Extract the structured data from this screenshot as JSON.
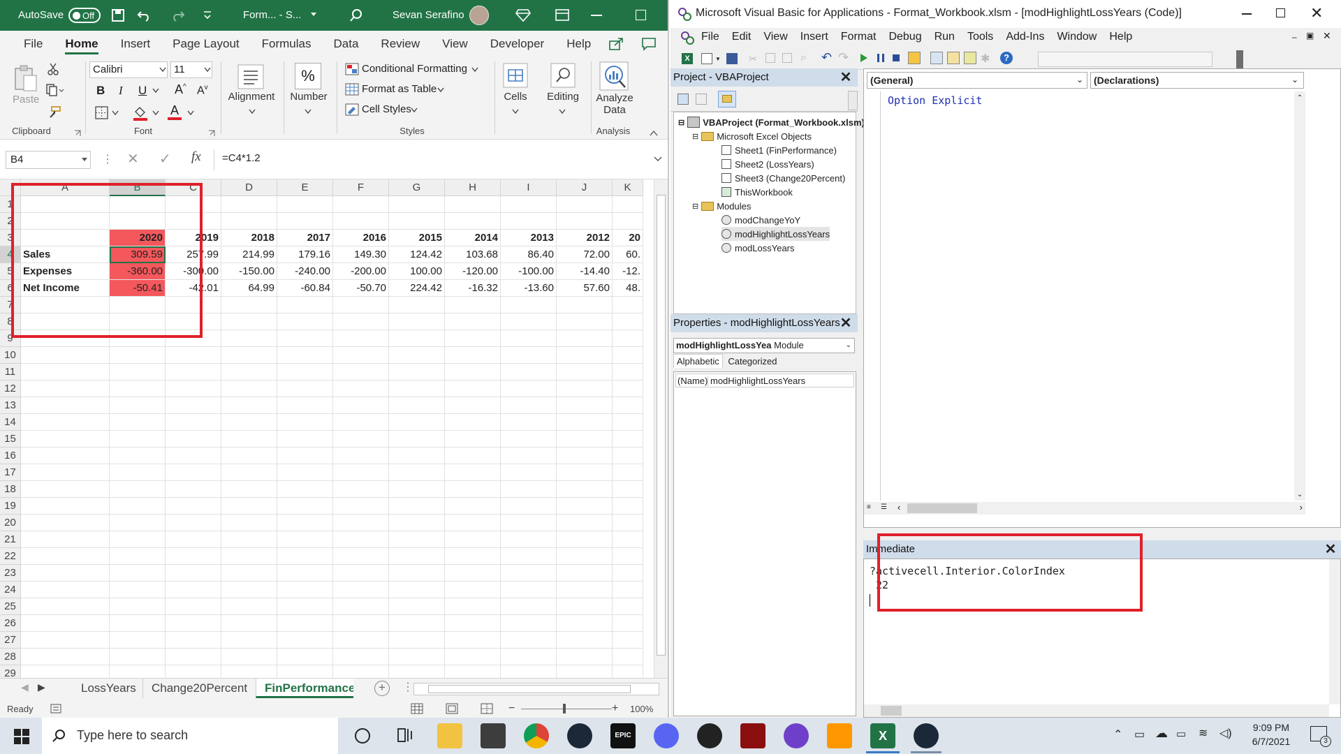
{
  "excel": {
    "autosave_label": "AutoSave",
    "autosave_state": "Off",
    "file_name": "Form... - S...",
    "user_name": "Sevan Serafino",
    "tabs": [
      "File",
      "Home",
      "Insert",
      "Page Layout",
      "Formulas",
      "Data",
      "Review",
      "View",
      "Developer",
      "Help"
    ],
    "ribbon": {
      "paste": "Paste",
      "clipboard": "Clipboard",
      "font_name": "Calibri",
      "font_size": "11",
      "font_group": "Font",
      "alignment": "Alignment",
      "number": "Number",
      "conditional_formatting": "Conditional Formatting",
      "format_as_table": "Format as Table",
      "cell_styles": "Cell Styles",
      "styles_group": "Styles",
      "cells": "Cells",
      "editing": "Editing",
      "analyze_data_1": "Analyze",
      "analyze_data_2": "Data",
      "analysis_group": "Analysis"
    },
    "name_box": "B4",
    "formula": "=C4*1.2",
    "columns": [
      "A",
      "B",
      "C",
      "D",
      "E",
      "F",
      "G",
      "H",
      "I",
      "J",
      "K"
    ],
    "rows": [
      "1",
      "2",
      "3",
      "4",
      "5",
      "6",
      "7",
      "8",
      "9",
      "10",
      "11",
      "12",
      "13",
      "14",
      "15",
      "16",
      "17",
      "18",
      "19",
      "20",
      "21",
      "22",
      "23",
      "24",
      "25",
      "26",
      "27",
      "28",
      "29"
    ],
    "years": [
      "2020",
      "2019",
      "2018",
      "2017",
      "2016",
      "2015",
      "2014",
      "2013",
      "2012",
      "20"
    ],
    "data_rows": [
      {
        "label": "Sales",
        "values": [
          "309.59",
          "257.99",
          "214.99",
          "179.16",
          "149.30",
          "124.42",
          "103.68",
          "86.40",
          "72.00",
          "60."
        ]
      },
      {
        "label": "Expenses",
        "values": [
          "-360.00",
          "-300.00",
          "-150.00",
          "-240.00",
          "-200.00",
          "100.00",
          "-120.00",
          "-100.00",
          "-14.40",
          "-12."
        ]
      },
      {
        "label": "Net Income",
        "values": [
          "-50.41",
          "-42.01",
          "64.99",
          "-60.84",
          "-50.70",
          "224.42",
          "-16.32",
          "-13.60",
          "57.60",
          "48."
        ]
      }
    ],
    "sheet_tabs": [
      "LossYears",
      "Change20Percent",
      "FinPerformance ..."
    ],
    "status": "Ready",
    "zoom": "100%",
    "highlight_color": "#f4585c"
  },
  "vba": {
    "title": "Microsoft Visual Basic for Applications - Format_Workbook.xlsm - [modHighlightLossYears (Code)]",
    "menu": [
      "File",
      "Edit",
      "View",
      "Insert",
      "Format",
      "Debug",
      "Run",
      "Tools",
      "Add-Ins",
      "Window",
      "Help"
    ],
    "project_title": "Project - VBAProject",
    "tree": {
      "root": "VBAProject (Format_Workbook.xlsm)",
      "excel_objects": "Microsoft Excel Objects",
      "sheets": [
        "Sheet1 (FinPerformance)",
        "Sheet2 (LossYears)",
        "Sheet3 (Change20Percent)",
        "ThisWorkbook"
      ],
      "modules_folder": "Modules",
      "modules": [
        "modChangeYoY",
        "modHighlightLossYears",
        "modLossYears"
      ]
    },
    "properties_title": "Properties - modHighlightLossYears",
    "properties_object": "modHighlightLossYea",
    "properties_type": "Module",
    "properties_tabs": [
      "Alphabetic",
      "Categorized"
    ],
    "property_name_key": "(Name)",
    "property_name_value": "modHighlightLossYears",
    "code_object": "(General)",
    "code_proc": "(Declarations)",
    "code_line": "Option Explicit",
    "immediate_title": "Immediate",
    "immediate_cmd": "?activecell.Interior.ColorIndex",
    "immediate_result": " 22"
  },
  "taskbar": {
    "search_placeholder": "Type here to search",
    "time": "9:09 PM",
    "date": "6/7/2021",
    "notification_count": "3"
  }
}
